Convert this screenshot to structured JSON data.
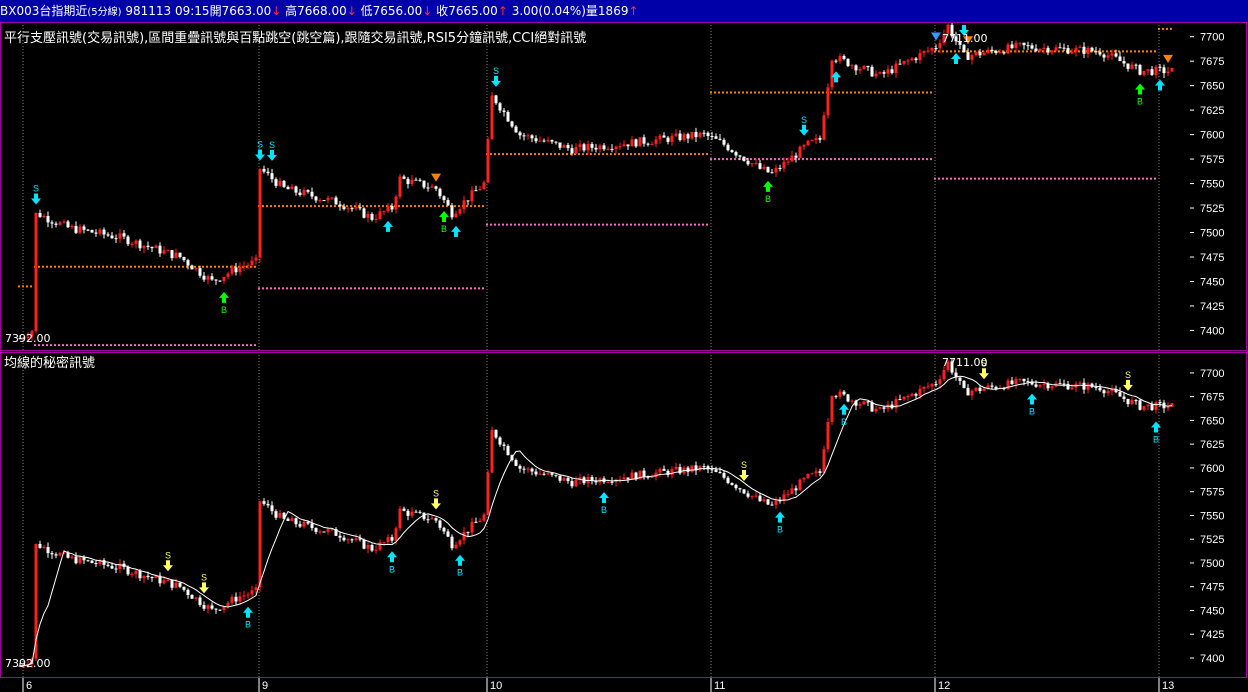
{
  "header": {
    "symbol": "BX003台指期近",
    "interval": "(5分線)",
    "date_time": "981113 09:15",
    "open_label": "開",
    "open": "7663.00",
    "high_label": "高",
    "high": "7668.00",
    "low_label": "低",
    "low": "7656.00",
    "close_label": "收",
    "close": "7665.00",
    "change": "3.00(0.04%)",
    "volume_label": "量",
    "volume": "1869",
    "down_mark": "↓",
    "up_mark": "↑"
  },
  "chart_data": [
    {
      "type": "candlestick",
      "title": "平行支壓訊號(交易訊號),區間重疊訊號與百點跳空(跳空篇),跟隨交易訊號,RSI5分鐘訊號,CCI絕對訊號",
      "ylim": [
        7380,
        7715
      ],
      "yticks": [
        7400,
        7425,
        7450,
        7475,
        7500,
        7525,
        7550,
        7575,
        7600,
        7625,
        7650,
        7675,
        7700
      ],
      "x_labels": [
        "6",
        "9",
        "10",
        "11",
        "12",
        "13"
      ],
      "max_label": "7711.00",
      "min_label": "7392.00",
      "anchors": [
        [
          0,
          7392
        ],
        [
          3,
          7400
        ],
        [
          4,
          7520
        ],
        [
          12,
          7505
        ],
        [
          25,
          7495
        ],
        [
          40,
          7475
        ],
        [
          48,
          7450
        ],
        [
          55,
          7465
        ],
        [
          59,
          7470
        ],
        [
          60,
          7565
        ],
        [
          66,
          7545
        ],
        [
          80,
          7530
        ],
        [
          88,
          7515
        ],
        [
          93,
          7525
        ],
        [
          95,
          7555
        ],
        [
          104,
          7545
        ],
        [
          108,
          7520
        ],
        [
          116,
          7550
        ],
        [
          118,
          7640
        ],
        [
          125,
          7600
        ],
        [
          138,
          7585
        ],
        [
          160,
          7595
        ],
        [
          171,
          7600
        ],
        [
          176,
          7590
        ],
        [
          185,
          7565
        ],
        [
          188,
          7560
        ],
        [
          197,
          7590
        ],
        [
          200,
          7595
        ],
        [
          203,
          7680
        ],
        [
          215,
          7660
        ],
        [
          229,
          7690
        ],
        [
          232,
          7711
        ],
        [
          236,
          7680
        ],
        [
          250,
          7690
        ],
        [
          270,
          7685
        ],
        [
          280,
          7665
        ],
        [
          288,
          7665
        ]
      ],
      "sr_lines": [
        {
          "from": 0,
          "to": 3,
          "y": 7445,
          "color": "#ff8000"
        },
        {
          "from": 4,
          "to": 59,
          "y": 7465,
          "color": "#ff8000"
        },
        {
          "from": 4,
          "to": 59,
          "y": 7385,
          "color": "#ff66cc"
        },
        {
          "from": 60,
          "to": 116,
          "y": 7527,
          "color": "#ff8000"
        },
        {
          "from": 60,
          "to": 116,
          "y": 7443,
          "color": "#ff66cc"
        },
        {
          "from": 117,
          "to": 172,
          "y": 7580,
          "color": "#ff8000"
        },
        {
          "from": 117,
          "to": 172,
          "y": 7508,
          "color": "#ff66cc"
        },
        {
          "from": 173,
          "to": 228,
          "y": 7643,
          "color": "#ff8000"
        },
        {
          "from": 173,
          "to": 228,
          "y": 7575,
          "color": "#ff66cc"
        },
        {
          "from": 229,
          "to": 284,
          "y": 7685,
          "color": "#ff8000"
        },
        {
          "from": 229,
          "to": 284,
          "y": 7555,
          "color": "#ff66cc"
        },
        {
          "from": 285,
          "to": 288,
          "y": 7708,
          "color": "#ff8000"
        }
      ],
      "signals": [
        {
          "i": 4,
          "kind": "sell",
          "label": "S",
          "color": "#00e5ff"
        },
        {
          "i": 51,
          "kind": "buy",
          "label": "B",
          "color": "#00ff00"
        },
        {
          "i": 60,
          "kind": "sell",
          "label": "S",
          "color": "#00e5ff"
        },
        {
          "i": 63,
          "kind": "sell",
          "label": "S",
          "color": "#00e5ff"
        },
        {
          "i": 92,
          "kind": "buy",
          "label": "",
          "color": "#00e5ff"
        },
        {
          "i": 104,
          "kind": "tri_down",
          "label": "",
          "color": "#ff8000"
        },
        {
          "i": 106,
          "kind": "buy",
          "label": "B",
          "color": "#00ff00"
        },
        {
          "i": 109,
          "kind": "buy",
          "label": "",
          "color": "#00e5ff"
        },
        {
          "i": 119,
          "kind": "sell",
          "label": "S",
          "color": "#00e5ff"
        },
        {
          "i": 187,
          "kind": "buy",
          "label": "B",
          "color": "#00ff00"
        },
        {
          "i": 196,
          "kind": "sell",
          "label": "S",
          "color": "#00e5ff"
        },
        {
          "i": 204,
          "kind": "buy",
          "label": "",
          "color": "#00e5ff"
        },
        {
          "i": 229,
          "kind": "tri_down",
          "label": "",
          "color": "#3399ff"
        },
        {
          "i": 232,
          "kind": "sell",
          "label": "",
          "color": "#cc66ff"
        },
        {
          "i": 234,
          "kind": "buy",
          "label": "",
          "color": "#00e5ff"
        },
        {
          "i": 236,
          "kind": "sell",
          "label": "",
          "color": "#00e5ff"
        },
        {
          "i": 237,
          "kind": "tri_down",
          "label": "",
          "color": "#ff8000"
        },
        {
          "i": 280,
          "kind": "buy",
          "label": "B",
          "color": "#00ff00"
        },
        {
          "i": 285,
          "kind": "buy",
          "label": "",
          "color": "#00e5ff"
        },
        {
          "i": 287,
          "kind": "tri_down",
          "label": "",
          "color": "#ff8000"
        }
      ]
    },
    {
      "type": "candlestick",
      "title": "均線的秘密訊號",
      "ylim": [
        7380,
        7722
      ],
      "yticks": [
        7400,
        7425,
        7450,
        7475,
        7500,
        7525,
        7550,
        7575,
        7600,
        7625,
        7650,
        7675,
        7700
      ],
      "max_label": "7711.00",
      "min_label": "7392.00",
      "signals": [
        {
          "i": 37,
          "kind": "sell",
          "label": "S",
          "color": "#ffff66"
        },
        {
          "i": 46,
          "kind": "sell",
          "label": "S",
          "color": "#ffff66"
        },
        {
          "i": 57,
          "kind": "buy",
          "label": "B",
          "color": "#00e5ff"
        },
        {
          "i": 93,
          "kind": "buy",
          "label": "B",
          "color": "#00e5ff"
        },
        {
          "i": 104,
          "kind": "sell",
          "label": "S",
          "color": "#ffff66"
        },
        {
          "i": 110,
          "kind": "buy",
          "label": "B",
          "color": "#00e5ff"
        },
        {
          "i": 146,
          "kind": "buy",
          "label": "B",
          "color": "#00e5ff"
        },
        {
          "i": 181,
          "kind": "sell",
          "label": "S",
          "color": "#ffff66"
        },
        {
          "i": 190,
          "kind": "buy",
          "label": "B",
          "color": "#00e5ff"
        },
        {
          "i": 206,
          "kind": "buy",
          "label": "B",
          "color": "#00e5ff"
        },
        {
          "i": 241,
          "kind": "sell",
          "label": "S",
          "color": "#ffff66"
        },
        {
          "i": 253,
          "kind": "buy",
          "label": "B",
          "color": "#00e5ff"
        },
        {
          "i": 277,
          "kind": "sell",
          "label": "S",
          "color": "#ffff66"
        },
        {
          "i": 284,
          "kind": "buy",
          "label": "B",
          "color": "#00e5ff"
        }
      ]
    }
  ],
  "colors": {
    "up": "#ff2020",
    "down": "#ffffff",
    "grid_dotted": "#808080",
    "panel_border": "#a000a0",
    "ma_line": "#ffffff"
  }
}
